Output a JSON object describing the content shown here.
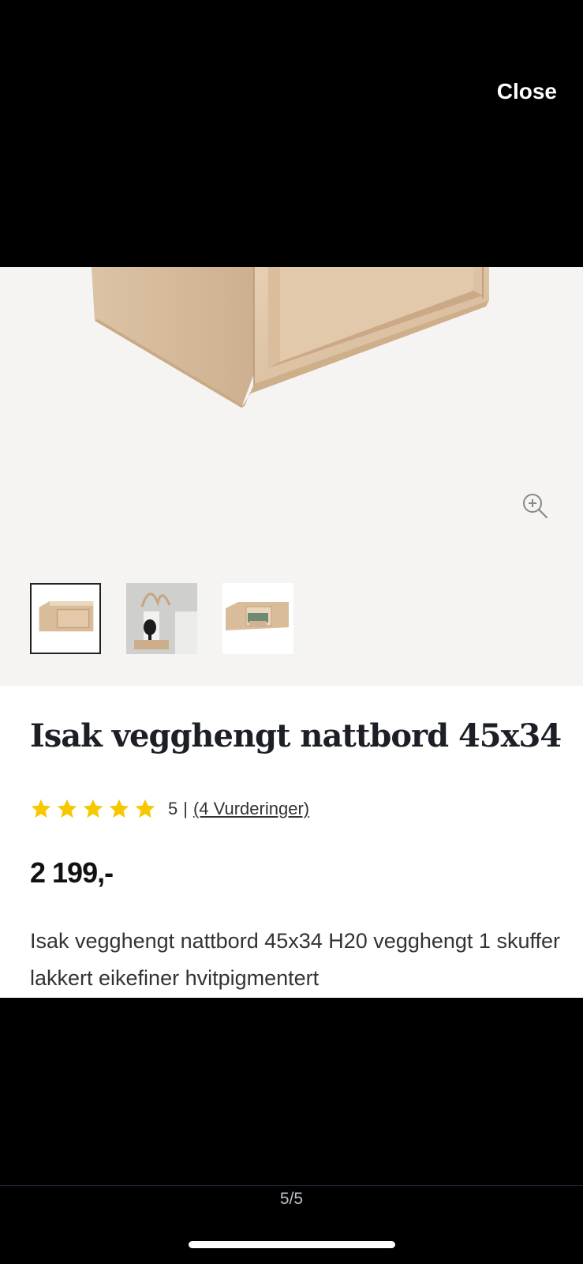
{
  "viewer": {
    "close_label": "Close",
    "pager": "5/5"
  },
  "gallery": {
    "zoom_icon": "zoom-in-icon",
    "thumbnails": [
      {
        "name": "thumb-front-view",
        "active": true
      },
      {
        "name": "thumb-room-view",
        "active": false
      },
      {
        "name": "thumb-open-drawer",
        "active": false
      }
    ]
  },
  "product": {
    "title": "Isak vegghengt nattbord 45x34",
    "rating": {
      "stars": 5,
      "score": "5",
      "separator": "|",
      "reviews_link": "(4 Vurderinger)",
      "star_color": "#f5c800"
    },
    "price": "2 199,-",
    "description": "Isak vegghengt nattbord 45x34 H20 vegghengt 1 skuffer lakkert eikefiner hvitpigmentert"
  }
}
